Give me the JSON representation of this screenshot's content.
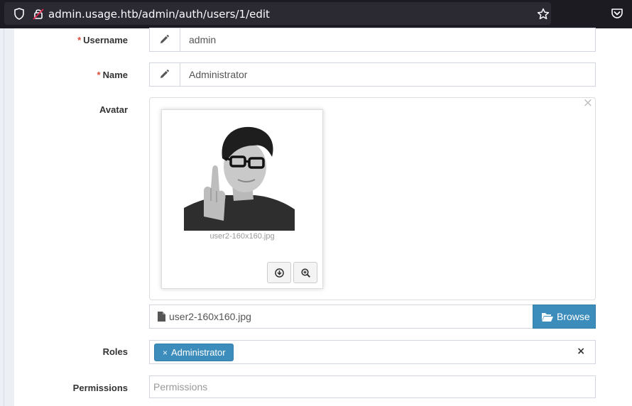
{
  "browser": {
    "url": "admin.usage.htb/admin/auth/users/1/edit"
  },
  "form": {
    "required_marker": "*",
    "username": {
      "label": "Username",
      "value": "admin",
      "icon": "pencil-icon"
    },
    "name": {
      "label": "Name",
      "value": "Administrator",
      "icon": "pencil-icon"
    },
    "avatar": {
      "label": "Avatar",
      "close_symbol": "×",
      "preview_caption": "user2-160x160.jpg",
      "file_name": "user2-160x160.jpg",
      "browse_label": "Browse"
    },
    "roles": {
      "label": "Roles",
      "tag_remove_symbol": "×",
      "selected": [
        "Administrator"
      ],
      "clear_symbol": "×"
    },
    "permissions": {
      "label": "Permissions",
      "placeholder": "Permissions"
    }
  },
  "colors": {
    "primary": "#3c8dbc",
    "required": "#dd4b39"
  }
}
